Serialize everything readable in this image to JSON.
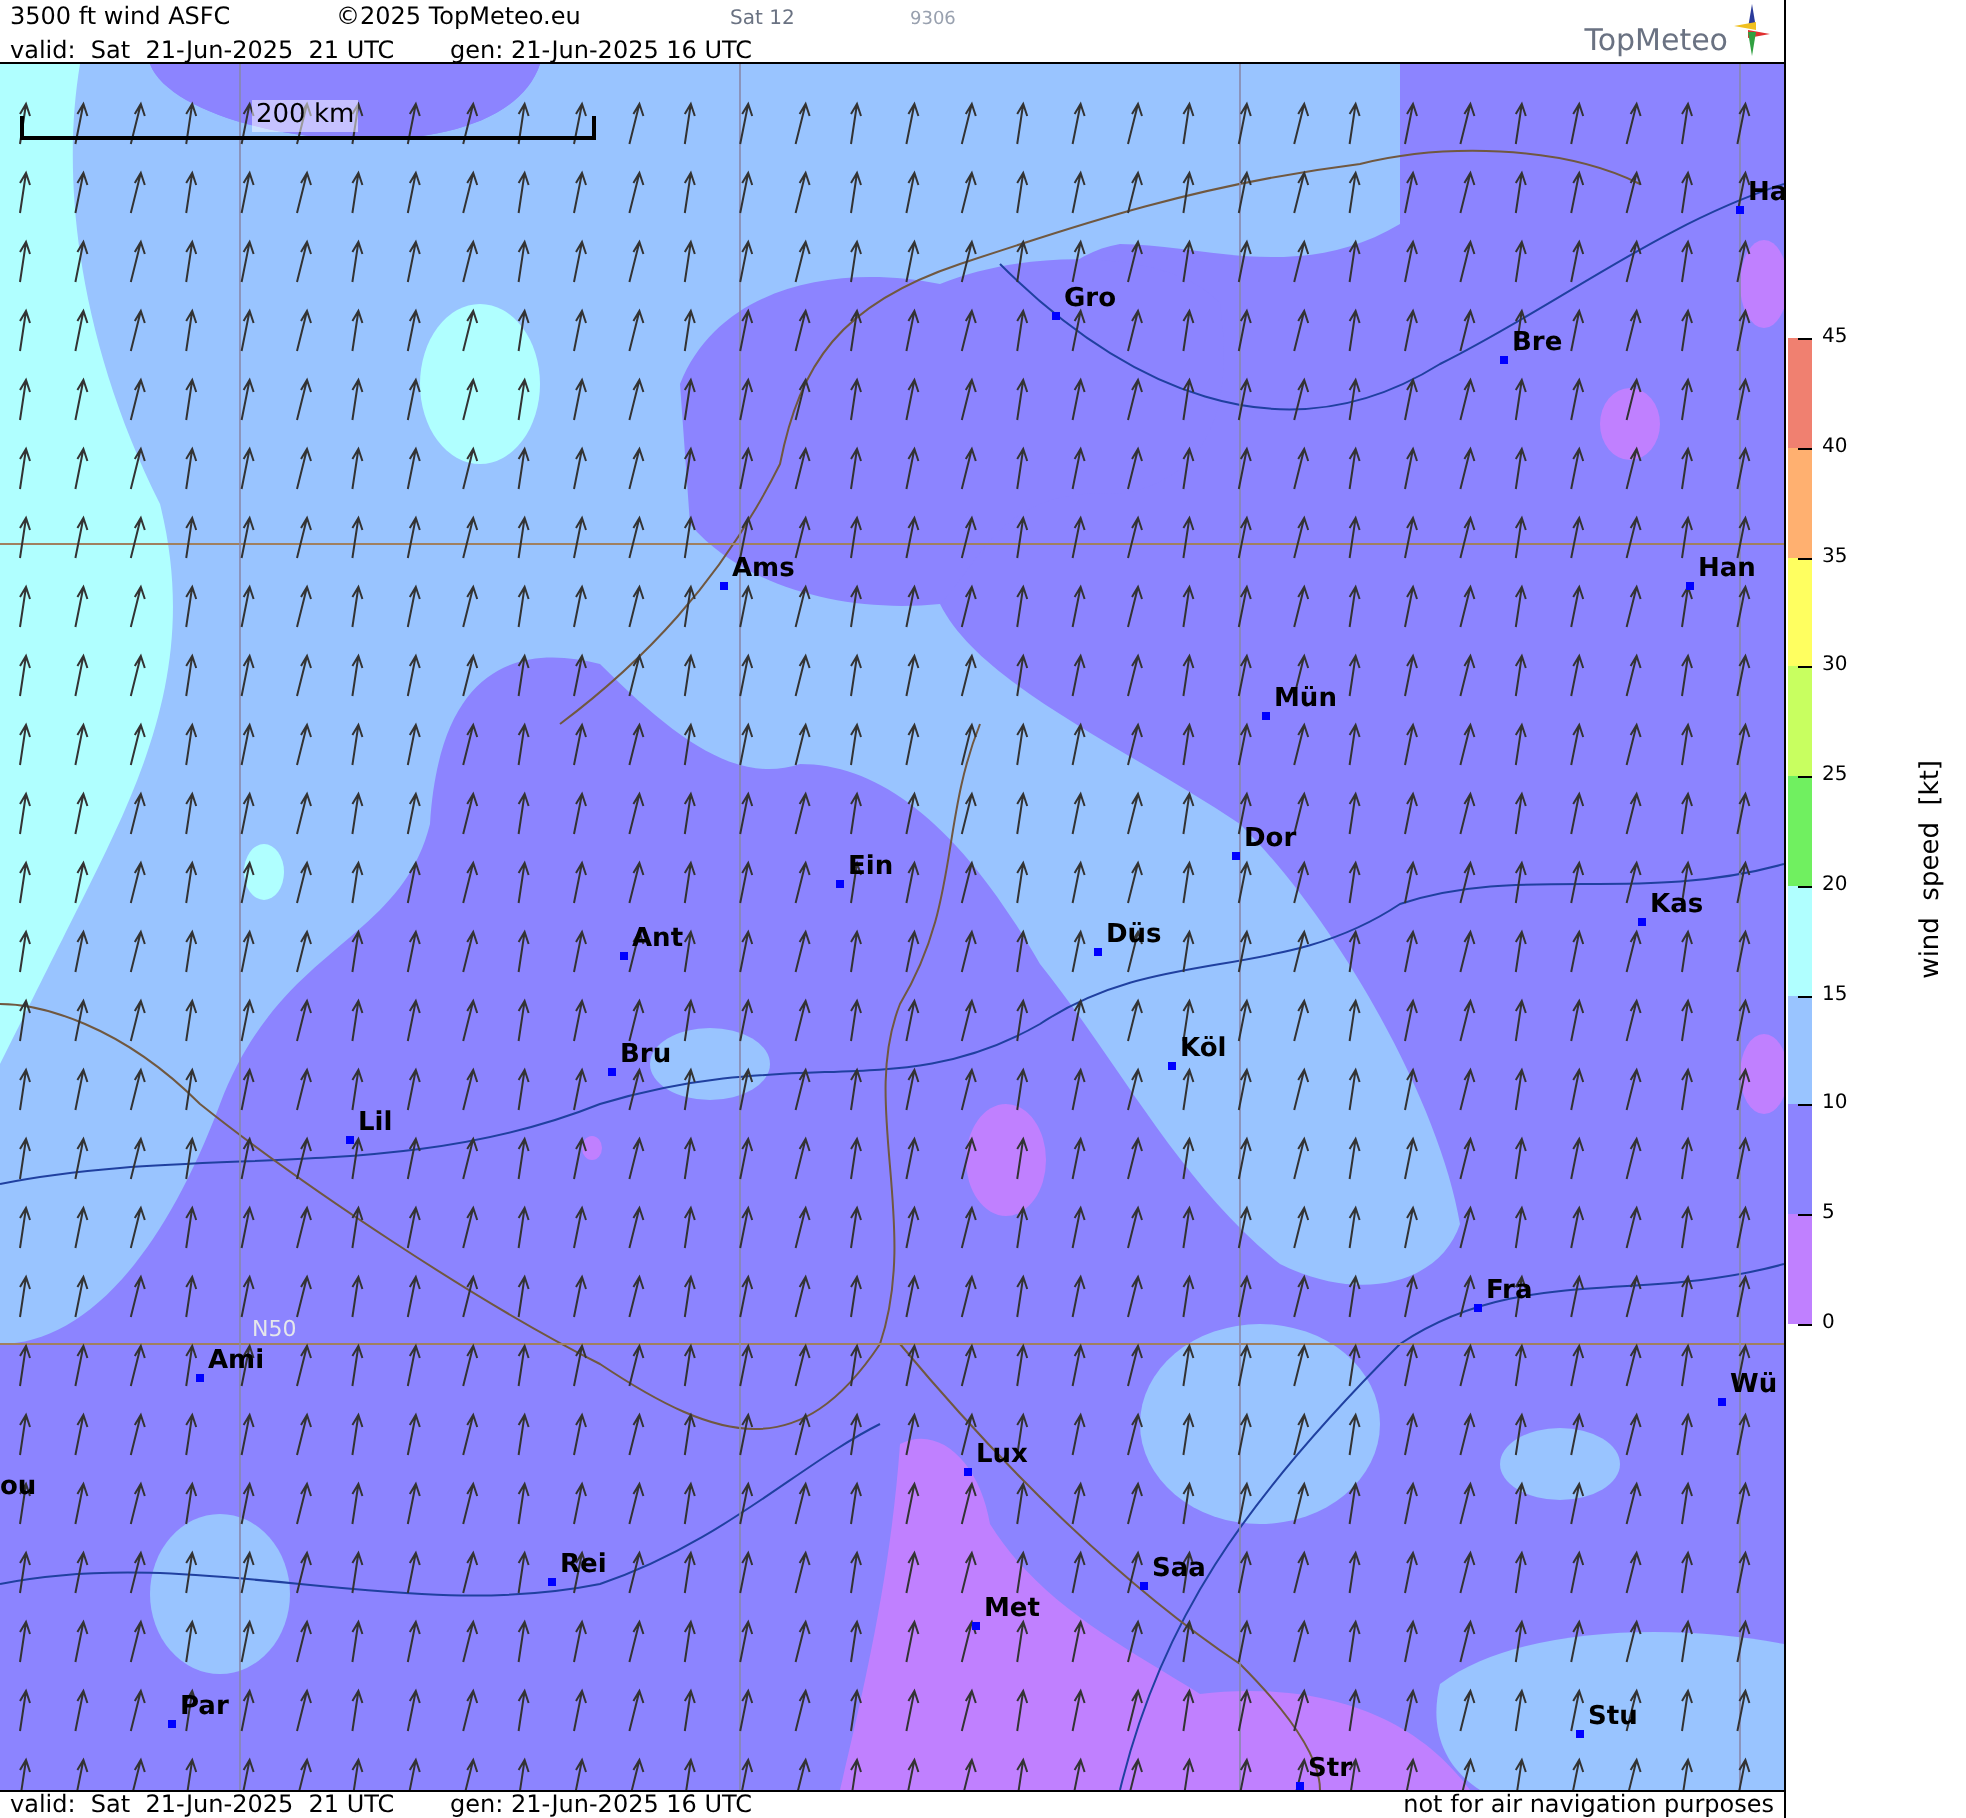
{
  "header": {
    "title": "3500 ft wind ASFC",
    "copyright": "©2025 TopMeteo.eu",
    "run_label": "Sat 12",
    "code": "9306",
    "valid": "valid:  Sat  21-Jun-2025  21 UTC",
    "generated": "gen: 21-Jun-2025 16 UTC",
    "logo_text": "TopMeteo"
  },
  "map": {
    "scale_label": "200 km",
    "latitude_label": "N50",
    "cities": [
      {
        "name": "Ha"
      },
      {
        "name": "Gro"
      },
      {
        "name": "Bre"
      },
      {
        "name": "Ams"
      },
      {
        "name": "Han"
      },
      {
        "name": "Mün"
      },
      {
        "name": "Dor"
      },
      {
        "name": "Ein"
      },
      {
        "name": "Kas"
      },
      {
        "name": "Düs"
      },
      {
        "name": "Ant"
      },
      {
        "name": "Köl"
      },
      {
        "name": "Bru"
      },
      {
        "name": "Lil"
      },
      {
        "name": "Fra"
      },
      {
        "name": "Ami"
      },
      {
        "name": "Wü"
      },
      {
        "name": "Lux"
      },
      {
        "name": "ou"
      },
      {
        "name": "Rei"
      },
      {
        "name": "Saa"
      },
      {
        "name": "Met"
      },
      {
        "name": "Stu"
      },
      {
        "name": "Par"
      },
      {
        "name": "Str"
      }
    ]
  },
  "legend": {
    "title": "wind speed [kt]",
    "ticks": [
      "45",
      "40",
      "35",
      "30",
      "25",
      "20",
      "15",
      "10",
      "5",
      "0"
    ],
    "bands": [
      {
        "color": "#f08070"
      },
      {
        "color": "#ffb070"
      },
      {
        "color": "#ffff60"
      },
      {
        "color": "#c8ff60"
      },
      {
        "color": "#70f060"
      },
      {
        "color": "#b0ffff"
      },
      {
        "color": "#99c4ff"
      },
      {
        "color": "#8c84ff"
      },
      {
        "color": "#c080ff"
      }
    ]
  },
  "footer": {
    "valid": "valid:  Sat  21-Jun-2025  21 UTC",
    "generated": "gen: 21-Jun-2025 16 UTC",
    "note": "not for air navigation purposes"
  }
}
